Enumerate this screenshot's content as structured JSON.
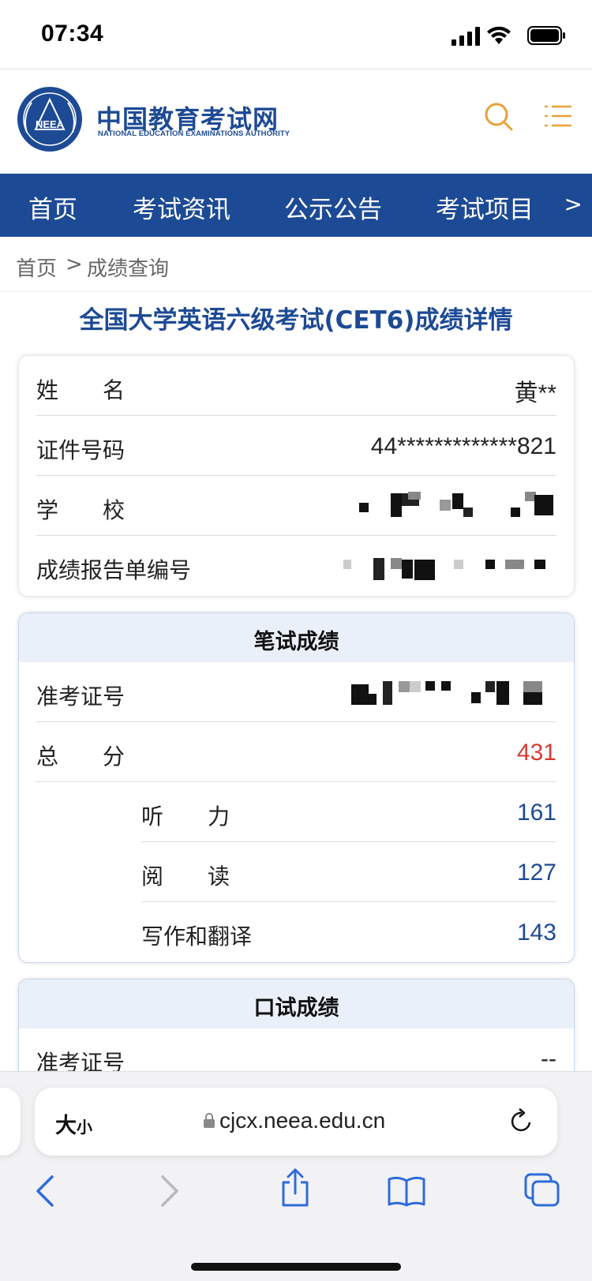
{
  "status_bar": {
    "time": "07:34"
  },
  "site": {
    "name_cn": "中国教育考试网",
    "name_en": "NATIONAL EDUCATION EXAMINATIONS AUTHORITY",
    "emblem_text": "NEEA",
    "brand_color": "#1d4a94",
    "accent_color": "#e8a23a",
    "icons": [
      "search-icon",
      "menu-icon"
    ]
  },
  "nav": {
    "items": [
      "首页",
      "考试资讯",
      "公示公告",
      "考试项目"
    ],
    "more": ">"
  },
  "breadcrumb": {
    "home": "首页",
    "sep": ">",
    "current": "成绩查询"
  },
  "page_title": "全国大学英语六级考试(CET6)成绩详情",
  "personal": {
    "rows": [
      {
        "label": "姓　　名",
        "value": "黄**"
      },
      {
        "label": "证件号码",
        "value": "44*************821"
      },
      {
        "label": "学　　校",
        "value": ""
      },
      {
        "label": "成绩报告单编号",
        "value": ""
      }
    ]
  },
  "written": {
    "heading": "笔试成绩",
    "admission_label": "准考证号",
    "total_label": "总　　分",
    "total_value": "431",
    "listening_label": "听　　力",
    "listening_value": "161",
    "reading_label": "阅　　读",
    "reading_value": "127",
    "writing_label": "写作和翻译",
    "writing_value": "143"
  },
  "oral": {
    "heading": "口试成绩",
    "admission_label": "准考证号",
    "admission_value": "--"
  },
  "browser": {
    "text_size_big": "大",
    "text_size_small": "小",
    "url": "cjcx.neea.edu.cn",
    "toolbar": [
      "back-icon",
      "forward-icon",
      "share-icon",
      "bookmarks-icon",
      "tabs-icon"
    ]
  }
}
